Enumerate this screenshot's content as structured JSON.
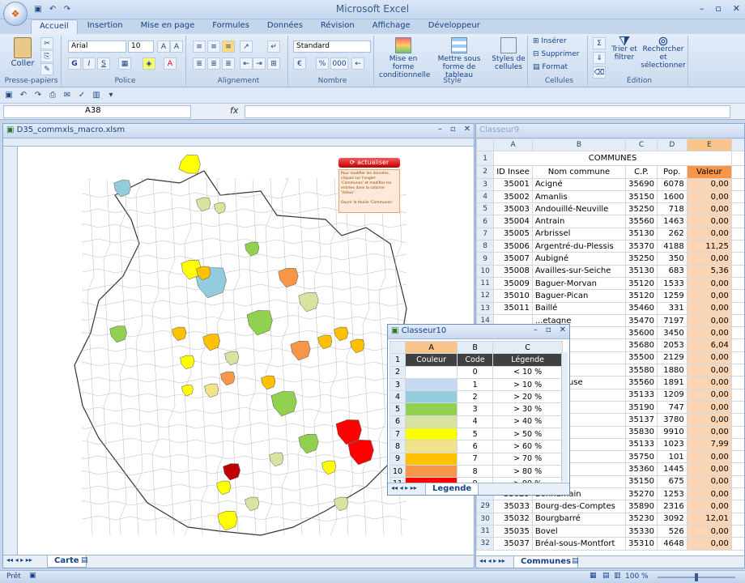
{
  "app": {
    "title": "Microsoft Excel"
  },
  "tabs": [
    "Accueil",
    "Insertion",
    "Mise en page",
    "Formules",
    "Données",
    "Révision",
    "Affichage",
    "Développeur"
  ],
  "ribbon": {
    "clipboard": {
      "label": "Presse-papiers",
      "paste": "Coller"
    },
    "font": {
      "label": "Police",
      "name": "Arial",
      "size": "10",
      "bold": "G",
      "italic": "I",
      "underline": "S"
    },
    "alignment": {
      "label": "Alignement"
    },
    "number": {
      "label": "Nombre",
      "format": "Standard",
      "percent": "%",
      "thousands": "000"
    },
    "style": {
      "label": "Style",
      "cond": "Mise en forme conditionnelle",
      "table": "Mettre sous forme de tableau",
      "cell": "Styles de cellules"
    },
    "cells": {
      "label": "Cellules",
      "insert": "Insérer",
      "delete": "Supprimer",
      "format": "Format"
    },
    "edition": {
      "label": "Édition",
      "sort": "Trier et filtrer",
      "find": "Rechercher et sélectionner"
    }
  },
  "formula": {
    "namebox": "A38",
    "fx": "fx"
  },
  "win_map": {
    "title": "D35_commxls_macro.xlsm",
    "tab": "Carte",
    "button": "actualiser",
    "info": "Pour modifier les données, cliquez sur l'onglet 'Communes' et modifiez les entrées dans la colonne 'Valeur'.",
    "link": "Ouvrir la feuille 'Communes'"
  },
  "win_communes": {
    "title": "Classeur9",
    "tab": "Communes",
    "header_title": "COMMUNES",
    "columns": [
      "ID Insee",
      "Nom commune",
      "C.P.",
      "Pop.",
      "Valeur"
    ],
    "col_letters": [
      "A",
      "B",
      "C",
      "D",
      "E"
    ],
    "rows": [
      [
        "3",
        "35001",
        "Acigné",
        "35690",
        "6078",
        "0,00"
      ],
      [
        "4",
        "35002",
        "Amanlis",
        "35150",
        "1600",
        "0,00"
      ],
      [
        "5",
        "35003",
        "Andouillé-Neuville",
        "35250",
        "718",
        "0,00"
      ],
      [
        "6",
        "35004",
        "Antrain",
        "35560",
        "1463",
        "0,00"
      ],
      [
        "7",
        "35005",
        "Arbrissel",
        "35130",
        "262",
        "0,00"
      ],
      [
        "8",
        "35006",
        "Argentré-du-Plessis",
        "35370",
        "4188",
        "11,25"
      ],
      [
        "9",
        "35007",
        "Aubigné",
        "35250",
        "350",
        "0,00"
      ],
      [
        "10",
        "35008",
        "Availles-sur-Seiche",
        "35130",
        "683",
        "5,36"
      ],
      [
        "11",
        "35009",
        "Baguer-Morvan",
        "35120",
        "1533",
        "0,00"
      ],
      [
        "12",
        "35010",
        "Baguer-Pican",
        "35120",
        "1259",
        "0,00"
      ],
      [
        "13",
        "35011",
        "Baillé",
        "35460",
        "331",
        "0,00"
      ],
      [
        "14",
        "",
        "...etagne",
        "35470",
        "7197",
        "0,00"
      ],
      [
        "15",
        "",
        "...oust",
        "35600",
        "3450",
        "0,00"
      ],
      [
        "16",
        "",
        "",
        "35680",
        "2053",
        "6,04"
      ],
      [
        "17",
        "",
        "",
        "35500",
        "2129",
        "0,00"
      ],
      [
        "18",
        "",
        "",
        "35580",
        "1880",
        "0,00"
      ],
      [
        "19",
        "",
        "...a-Pérouse",
        "35560",
        "1891",
        "0,00"
      ],
      [
        "20",
        "",
        "",
        "35133",
        "1209",
        "0,00"
      ],
      [
        "21",
        "",
        "",
        "35190",
        "747",
        "0,00"
      ],
      [
        "22",
        "",
        "",
        "35137",
        "3780",
        "0,00"
      ],
      [
        "23",
        "",
        "",
        "35830",
        "9910",
        "0,00"
      ],
      [
        "24",
        "",
        "",
        "35133",
        "1023",
        "7,99"
      ],
      [
        "25",
        "",
        "",
        "35750",
        "101",
        "0,00"
      ],
      [
        "26",
        "",
        "",
        "35360",
        "1445",
        "0,00"
      ],
      [
        "27",
        "",
        "",
        "35150",
        "675",
        "0,00"
      ],
      [
        "28",
        "35029",
        "Bonnemain",
        "35270",
        "1253",
        "0,00"
      ],
      [
        "29",
        "35033",
        "Bourg-des-Comptes",
        "35890",
        "2316",
        "0,00"
      ],
      [
        "30",
        "35032",
        "Bourgbarré",
        "35230",
        "3092",
        "12,01"
      ],
      [
        "31",
        "35035",
        "Bovel",
        "35330",
        "526",
        "0,00"
      ],
      [
        "32",
        "35037",
        "Bréal-sous-Montfort",
        "35310",
        "4648",
        "0,00"
      ]
    ]
  },
  "win_legend": {
    "title": "Classeur10",
    "tab": "Legende",
    "columns": [
      "Couleur",
      "Code",
      "Légende"
    ],
    "col_letters": [
      "A",
      "B",
      "C"
    ],
    "rows": [
      {
        "n": "2",
        "color": "#ffffff",
        "code": "0",
        "label": "< 10 %"
      },
      {
        "n": "3",
        "color": "#c6d9f1",
        "code": "1",
        "label": "> 10 %"
      },
      {
        "n": "4",
        "color": "#93cddd",
        "code": "2",
        "label": "> 20 %"
      },
      {
        "n": "5",
        "color": "#92d050",
        "code": "3",
        "label": "> 30 %"
      },
      {
        "n": "6",
        "color": "#d7e4a0",
        "code": "4",
        "label": "> 40 %"
      },
      {
        "n": "7",
        "color": "#ffff00",
        "code": "5",
        "label": "> 50 %"
      },
      {
        "n": "8",
        "color": "#f2e28c",
        "code": "6",
        "label": "> 60 %"
      },
      {
        "n": "9",
        "color": "#ffc000",
        "code": "7",
        "label": "> 70 %"
      },
      {
        "n": "10",
        "color": "#f79646",
        "code": "8",
        "label": "> 80 %"
      },
      {
        "n": "11",
        "color": "#ff0000",
        "code": "9",
        "label": "> 90 %"
      },
      {
        "n": "12",
        "color": "#c00000",
        "code": "10",
        "label": "Max."
      }
    ]
  },
  "status": {
    "ready": "Prêt",
    "zoom": "100 %"
  }
}
